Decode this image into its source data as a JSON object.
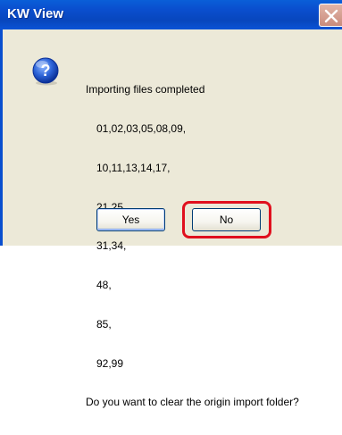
{
  "window": {
    "title": "KW View",
    "close_icon": "close-icon"
  },
  "message": {
    "icon": "question-icon",
    "heading": "Importing files completed",
    "file_lines": [
      "01,02,03,05,08,09,",
      "10,11,13,14,17,",
      "21,25,",
      "31,34,",
      "48,",
      "85,",
      "92,99"
    ],
    "question": "Do you want to clear the origin import folder?"
  },
  "buttons": {
    "yes_label": "Yes",
    "no_label": "No"
  },
  "colors": {
    "titlebar": "#0a4fcf",
    "dialog_bg": "#ece9d8",
    "highlight": "#e0101e"
  }
}
